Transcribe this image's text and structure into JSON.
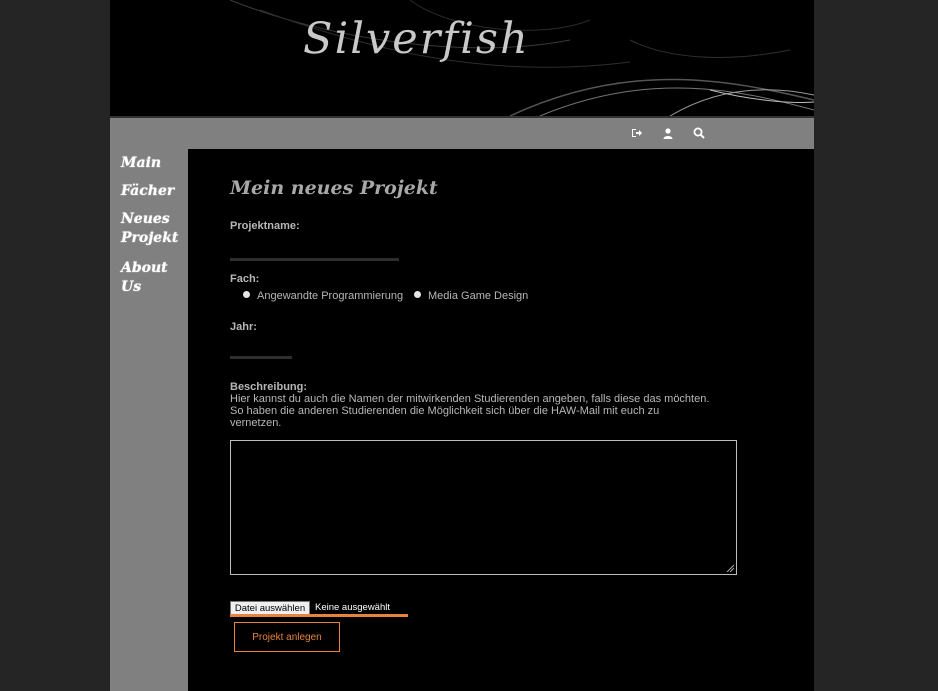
{
  "header": {
    "brand": "Silverfish"
  },
  "topbar": {
    "icons": [
      "logout-icon",
      "user-icon",
      "search-icon"
    ]
  },
  "sidebar": {
    "items": [
      {
        "label": "Main"
      },
      {
        "label": "Fächer"
      },
      {
        "label": "Neues Projekt"
      },
      {
        "label": "About Us"
      }
    ]
  },
  "form": {
    "title": "Mein neues Projekt",
    "projektname_label": "Projektname:",
    "projektname_value": "",
    "fach_label": "Fach:",
    "fach_options": [
      {
        "label": "Angewandte Programmierung"
      },
      {
        "label": "Media Game Design"
      }
    ],
    "jahr_label": "Jahr:",
    "jahr_value": "",
    "beschreibung_label": "Beschreibung:",
    "beschreibung_hint": "Hier kannst du auch die Namen der mitwirkenden Studierenden angeben, falls diese das möchten. So haben die anderen Studierenden die Möglichkeit sich über die HAW-Mail mit euch zu vernetzen.",
    "file_button_label": "Datei auswählen",
    "file_status": "Keine ausgewählt",
    "submit_label": "Projekt anlegen"
  },
  "colors": {
    "accent": "#e8833a",
    "sidebar": "#808080",
    "background": "#252525"
  }
}
